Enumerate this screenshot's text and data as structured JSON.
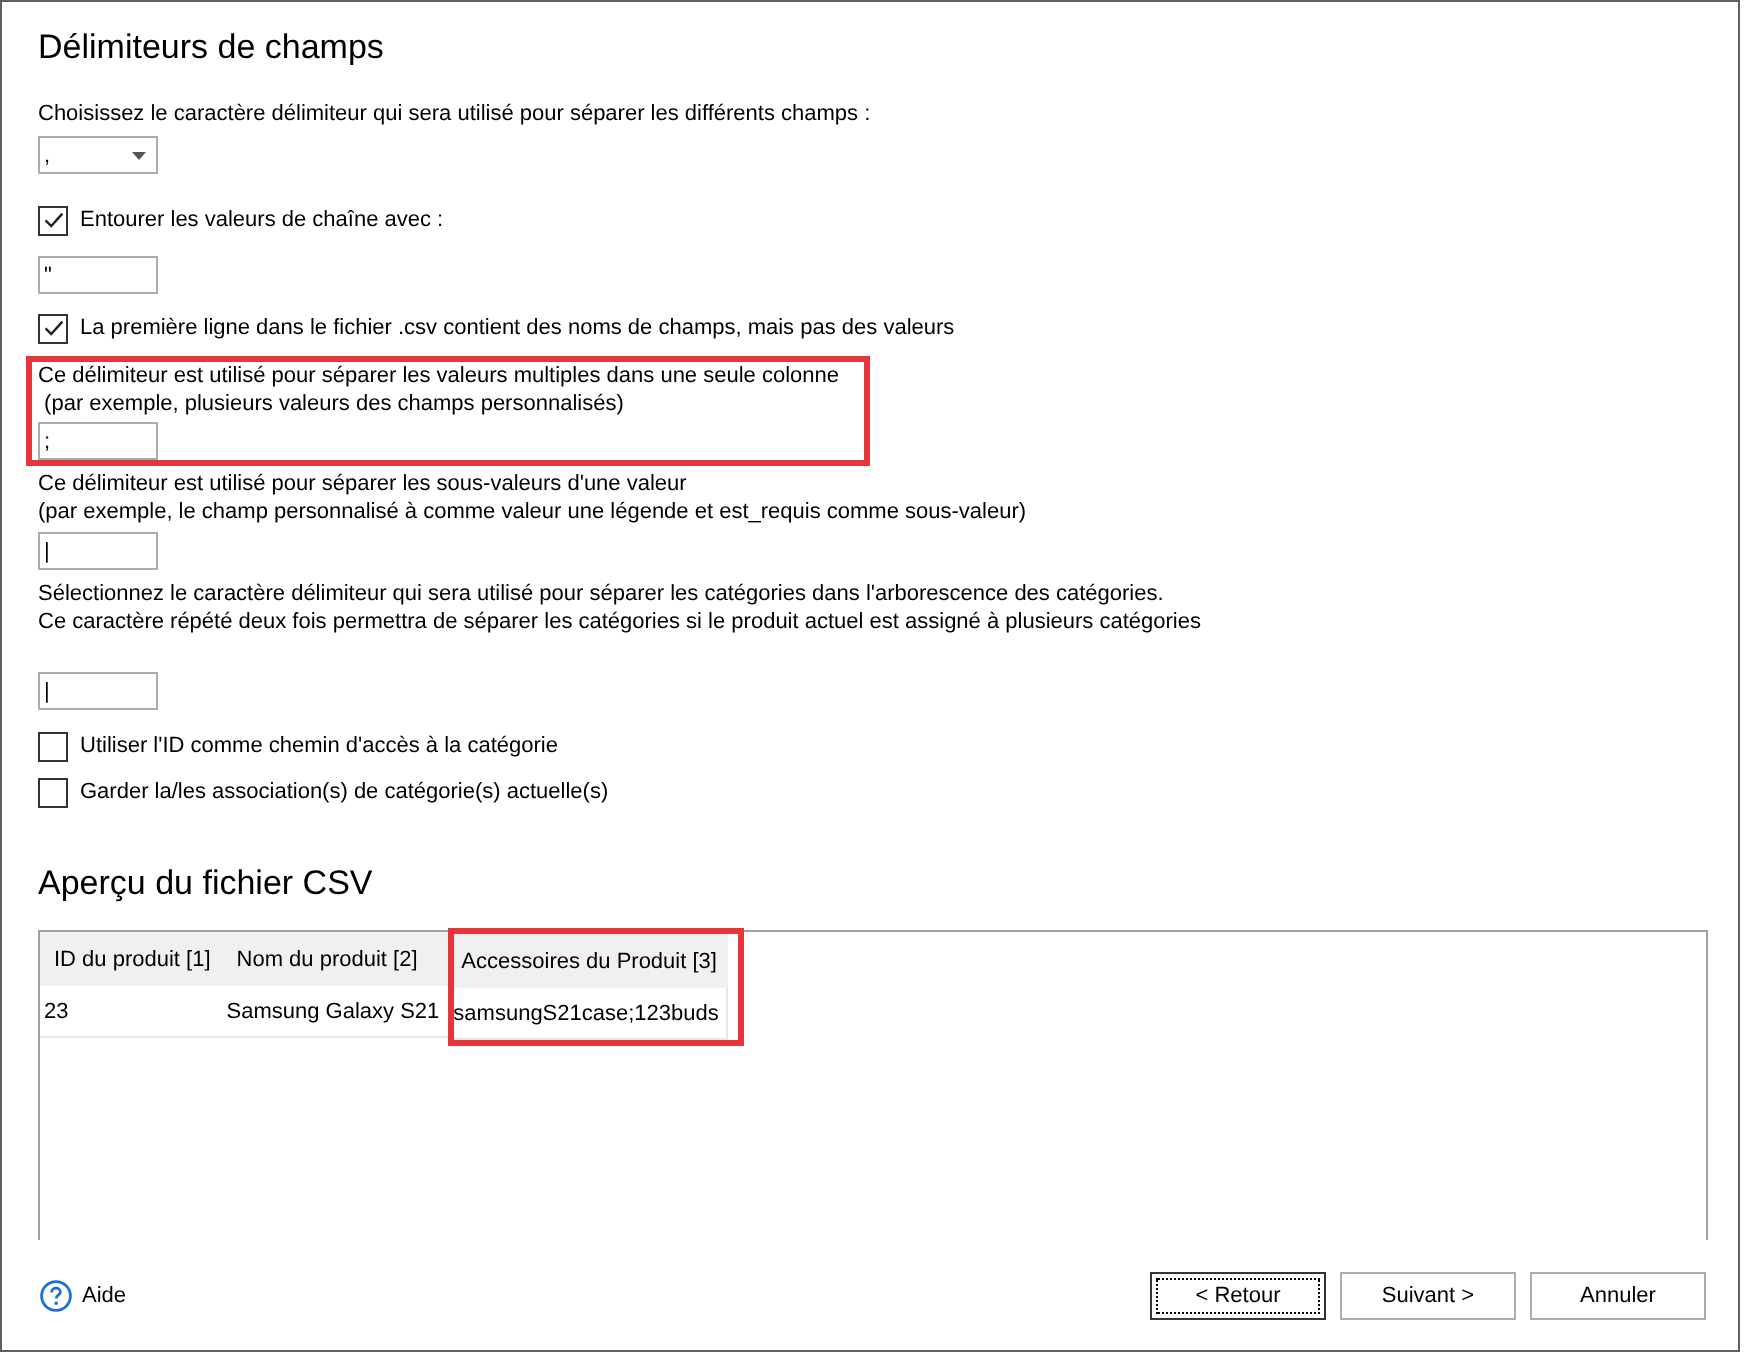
{
  "delimiters": {
    "title": "Délimiteurs de champs",
    "items": [
      {
        "kind": "text",
        "lines": [
          "Choisissez le caractère délimiteur qui sera utilisé pour séparer les différents champs :"
        ]
      },
      {
        "kind": "dropdown",
        "value": ","
      },
      {
        "kind": "checkbox",
        "label": "Entourer les valeurs de chaîne avec :",
        "checked": true
      },
      {
        "kind": "input",
        "value": "\""
      },
      {
        "kind": "checkbox",
        "label": "La première ligne dans le fichier .csv contient des noms de champs, mais pas des valeurs",
        "checked": true
      },
      {
        "kind": "group",
        "highlighted": true,
        "lines": [
          "Ce délimiteur est utilisé pour séparer les valeurs multiples dans une seule colonne",
          " (par exemple, plusieurs valeurs des champs personnalisés)"
        ],
        "value": ";"
      },
      {
        "kind": "group",
        "highlighted": false,
        "lines": [
          "Ce délimiteur est utilisé pour séparer les sous-valeurs d'une valeur",
          "(par exemple, le champ personnalisé à comme valeur une légende et est_requis comme sous-valeur)"
        ],
        "value": "|"
      },
      {
        "kind": "group",
        "highlighted": false,
        "lines": [
          "Sélectionnez le caractère délimiteur qui sera utilisé pour séparer les catégories dans l'arborescence des catégories.",
          "Ce caractère répété deux fois permettra de séparer les catégories si le produit actuel est assigné à plusieurs catégories"
        ],
        "value": "|"
      },
      {
        "kind": "checkbox",
        "label": "Utiliser l'ID comme chemin d'accès à la catégorie",
        "checked": false
      },
      {
        "kind": "checkbox",
        "label": "Garder la/les association(s) de catégorie(s) actuelle(s)",
        "checked": false
      }
    ]
  },
  "preview": {
    "title": "Aperçu du fichier CSV",
    "columns": [
      {
        "label": "ID du produit [1]",
        "highlighted": false
      },
      {
        "label": "Nom du produit [2]",
        "highlighted": false
      },
      {
        "label": "Accessoires du Produit [3]",
        "highlighted": true
      }
    ],
    "rows": [
      [
        "23",
        "Samsung Galaxy S21",
        "samsungS21case;123buds"
      ]
    ]
  },
  "footer": {
    "help": "Aide",
    "buttons": [
      {
        "label": "< Retour",
        "focused": true
      },
      {
        "label": "Suivant >",
        "focused": false
      },
      {
        "label": "Annuler",
        "focused": false
      }
    ]
  }
}
